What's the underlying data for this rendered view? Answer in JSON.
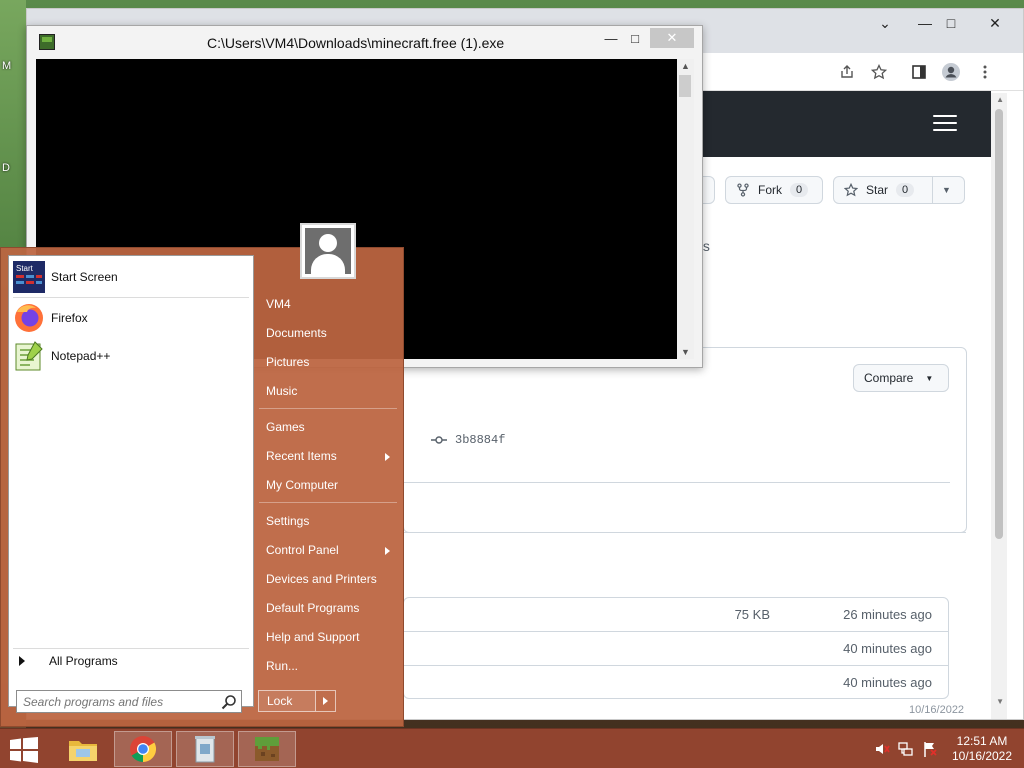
{
  "desktop": {
    "edge_labels": [
      "M",
      "D"
    ]
  },
  "browser": {
    "window_controls": {
      "tab_search": "⌄",
      "minimize": "—",
      "maximize": "□",
      "close": "✕"
    },
    "repo_actions": {
      "fork_label": "Fork",
      "fork_count": "0",
      "star_label": "Star",
      "star_count": "0"
    },
    "partial_text": "ts",
    "compare_label": "Compare",
    "commit_hash": "3b8884f",
    "files": [
      {
        "size": "75 KB",
        "time": "26 minutes ago"
      },
      {
        "size": "",
        "time": "40 minutes ago"
      },
      {
        "size": "",
        "time": "40 minutes ago"
      }
    ],
    "bottom_partial": "10/16/2022"
  },
  "console": {
    "title": "C:\\Users\\VM4\\Downloads\\minecraft.free (1).exe",
    "minimize": "—",
    "maximize": "□",
    "close": "✕"
  },
  "start_menu": {
    "pinned": [
      {
        "label": "Start Screen",
        "icon": "start-screen-icon"
      },
      {
        "label": "Firefox",
        "icon": "firefox-icon"
      },
      {
        "label": "Notepad++",
        "icon": "notepad-plus-plus-icon"
      }
    ],
    "start_icon_text": "Start",
    "all_programs": "All Programs",
    "search_placeholder": "Search programs and files",
    "right_column": {
      "user": "VM4",
      "documents": "Documents",
      "pictures": "Pictures",
      "music": "Music",
      "games": "Games",
      "recent_items": "Recent Items",
      "my_computer": "My Computer",
      "settings": "Settings",
      "control_panel": "Control Panel",
      "devices_printers": "Devices and Printers",
      "default_programs": "Default Programs",
      "help_support": "Help and Support",
      "run": "Run..."
    },
    "lock_label": "Lock"
  },
  "taskbar": {
    "apps": [
      "file-explorer-icon",
      "chrome-icon",
      "recycle-bin-icon",
      "minecraft-icon"
    ],
    "time": "12:51 AM",
    "date": "10/16/2022"
  },
  "colors": {
    "start_menu_bg": "#bc6541",
    "taskbar_bg": "#964630",
    "github_header": "#24292f"
  }
}
